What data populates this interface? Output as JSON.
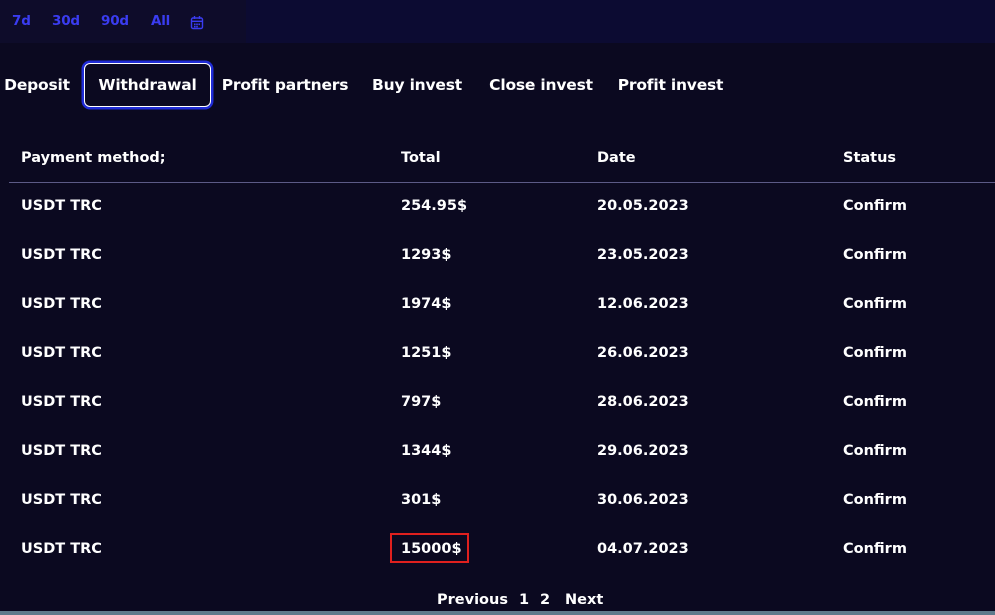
{
  "period_filter": {
    "options": [
      "7d",
      "30d",
      "90d",
      "All"
    ],
    "calendar_icon": "calendar-icon",
    "accent_color": "#3a3cf0"
  },
  "tabs": [
    {
      "label": "Deposit",
      "active": false
    },
    {
      "label": "Withdrawal",
      "active": true
    },
    {
      "label": "Profit partners",
      "active": false
    },
    {
      "label": "Buy invest",
      "active": false
    },
    {
      "label": "Close invest",
      "active": false
    },
    {
      "label": "Profit invest",
      "active": false
    }
  ],
  "table": {
    "headers": [
      "Payment method;",
      "Total",
      "Date",
      "Status"
    ],
    "rows": [
      {
        "method": "USDT TRC",
        "total": "254.95$",
        "date": "20.05.2023",
        "status": "Confirm"
      },
      {
        "method": "USDT TRC",
        "total": "1293$",
        "date": "23.05.2023",
        "status": "Confirm"
      },
      {
        "method": "USDT TRC",
        "total": "1974$",
        "date": "12.06.2023",
        "status": "Confirm"
      },
      {
        "method": "USDT TRC",
        "total": "1251$",
        "date": "26.06.2023",
        "status": "Confirm"
      },
      {
        "method": "USDT TRC",
        "total": "797$",
        "date": "28.06.2023",
        "status": "Confirm"
      },
      {
        "method": "USDT TRC",
        "total": "1344$",
        "date": "29.06.2023",
        "status": "Confirm"
      },
      {
        "method": "USDT TRC",
        "total": "301$",
        "date": "30.06.2023",
        "status": "Confirm"
      },
      {
        "method": "USDT TRC",
        "total": "15000$",
        "date": "04.07.2023",
        "status": "Confirm",
        "highlighted": true
      }
    ]
  },
  "pagination": {
    "previous": "Previous",
    "pages": [
      "1",
      "2"
    ],
    "next": "Next"
  },
  "colors": {
    "background": "#0b0920",
    "highlight_box": "#e0201e",
    "active_tab_glow": "#1f2bd6"
  }
}
